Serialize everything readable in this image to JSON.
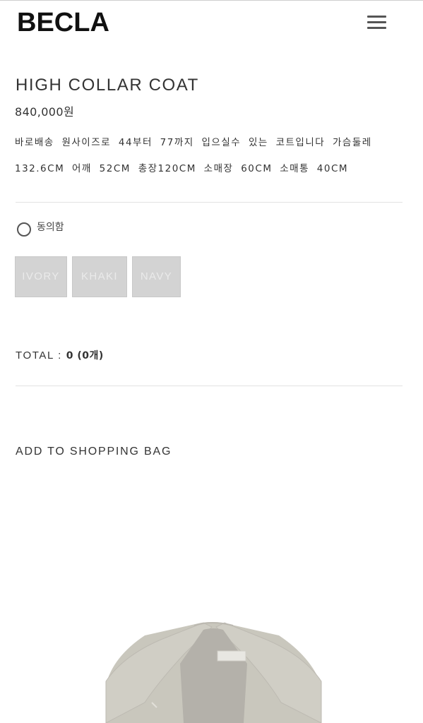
{
  "header": {
    "logo": "BECLA",
    "menu_icon": "hamburger-menu-icon"
  },
  "product": {
    "title": "HIGH COLLAR COAT",
    "price": "840,000원",
    "description_line1": "바로배송 원사이즈로 44부터 77까지 입으실수 있는 코트입니다 가슴둘레",
    "description_line2": "132.6CM 어깨 52CM 총장120CM 소매장 60CM 소매통 40CM"
  },
  "agreement": {
    "label": "동의함",
    "checked": false
  },
  "options": [
    {
      "label": "IVORY"
    },
    {
      "label": "KHAKI"
    },
    {
      "label": "NAVY"
    }
  ],
  "total": {
    "label": "TOTAL : ",
    "value": "0 (0개)"
  },
  "cart": {
    "add_label": "ADD TO SHOPPING BAG"
  },
  "colors": {
    "option_bg": "#d3d3d3",
    "option_text": "#eaeaea",
    "coat": "#c9c7bd",
    "coat_inner": "#b4b1aa",
    "divider": "#e2e2e2"
  }
}
